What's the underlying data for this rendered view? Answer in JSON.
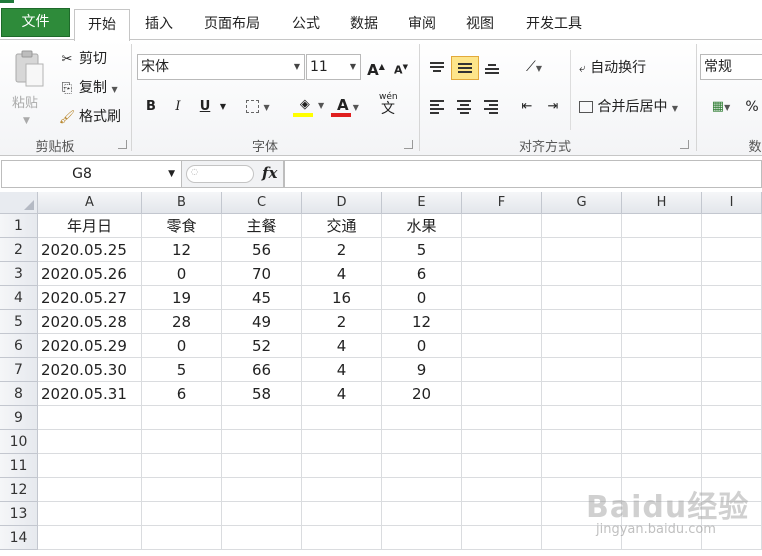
{
  "ribbon_tabs": [
    {
      "label": "文件"
    },
    {
      "label": "开始"
    },
    {
      "label": "插入"
    },
    {
      "label": "页面布局"
    },
    {
      "label": "公式"
    },
    {
      "label": "数据"
    },
    {
      "label": "审阅"
    },
    {
      "label": "视图"
    },
    {
      "label": "开发工具"
    }
  ],
  "active_tab": "开始",
  "clipboard": {
    "paste": "粘贴",
    "cut": "剪切",
    "copy": "复制",
    "format_painter": "格式刷",
    "group_label": "剪贴板"
  },
  "font": {
    "name": "宋体",
    "size": "11",
    "grow_icon": "A",
    "shrink_icon": "A",
    "bold": "B",
    "italic": "I",
    "underline": "U",
    "font_color_letter": "A",
    "wen_letter": "wén",
    "wen_char": "文",
    "group_label": "字体",
    "fill_color": "#ffff00",
    "font_color": "#e01f1f"
  },
  "alignment": {
    "wrap_text": "自动换行",
    "merge_center": "合并后居中",
    "group_label": "对齐方式"
  },
  "number": {
    "format": "常规",
    "percent": "%",
    "group_label_partial": "数"
  },
  "formula_bar": {
    "name_box": "G8",
    "fx": "fx",
    "formula": ""
  },
  "sheet": {
    "columns": [
      "A",
      "B",
      "C",
      "D",
      "E",
      "F",
      "G",
      "H",
      "I"
    ],
    "row_numbers": [
      "1",
      "2",
      "3",
      "4",
      "5",
      "6",
      "7",
      "8",
      "9",
      "10",
      "11",
      "12",
      "13",
      "14"
    ],
    "header_row": [
      "年月日",
      "零食",
      "主餐",
      "交通",
      "水果"
    ],
    "data_rows": [
      [
        "2020.05.25",
        "12",
        "56",
        "2",
        "5"
      ],
      [
        "2020.05.26",
        "0",
        "70",
        "4",
        "6"
      ],
      [
        "2020.05.27",
        "19",
        "45",
        "16",
        "0"
      ],
      [
        "2020.05.28",
        "28",
        "49",
        "2",
        "12"
      ],
      [
        "2020.05.29",
        "0",
        "52",
        "4",
        "0"
      ],
      [
        "2020.05.30",
        "5",
        "66",
        "4",
        "9"
      ],
      [
        "2020.05.31",
        "6",
        "58",
        "4",
        "20"
      ]
    ]
  },
  "watermark": {
    "text": "Baidu经验",
    "url": "jingyan.baidu.com"
  }
}
